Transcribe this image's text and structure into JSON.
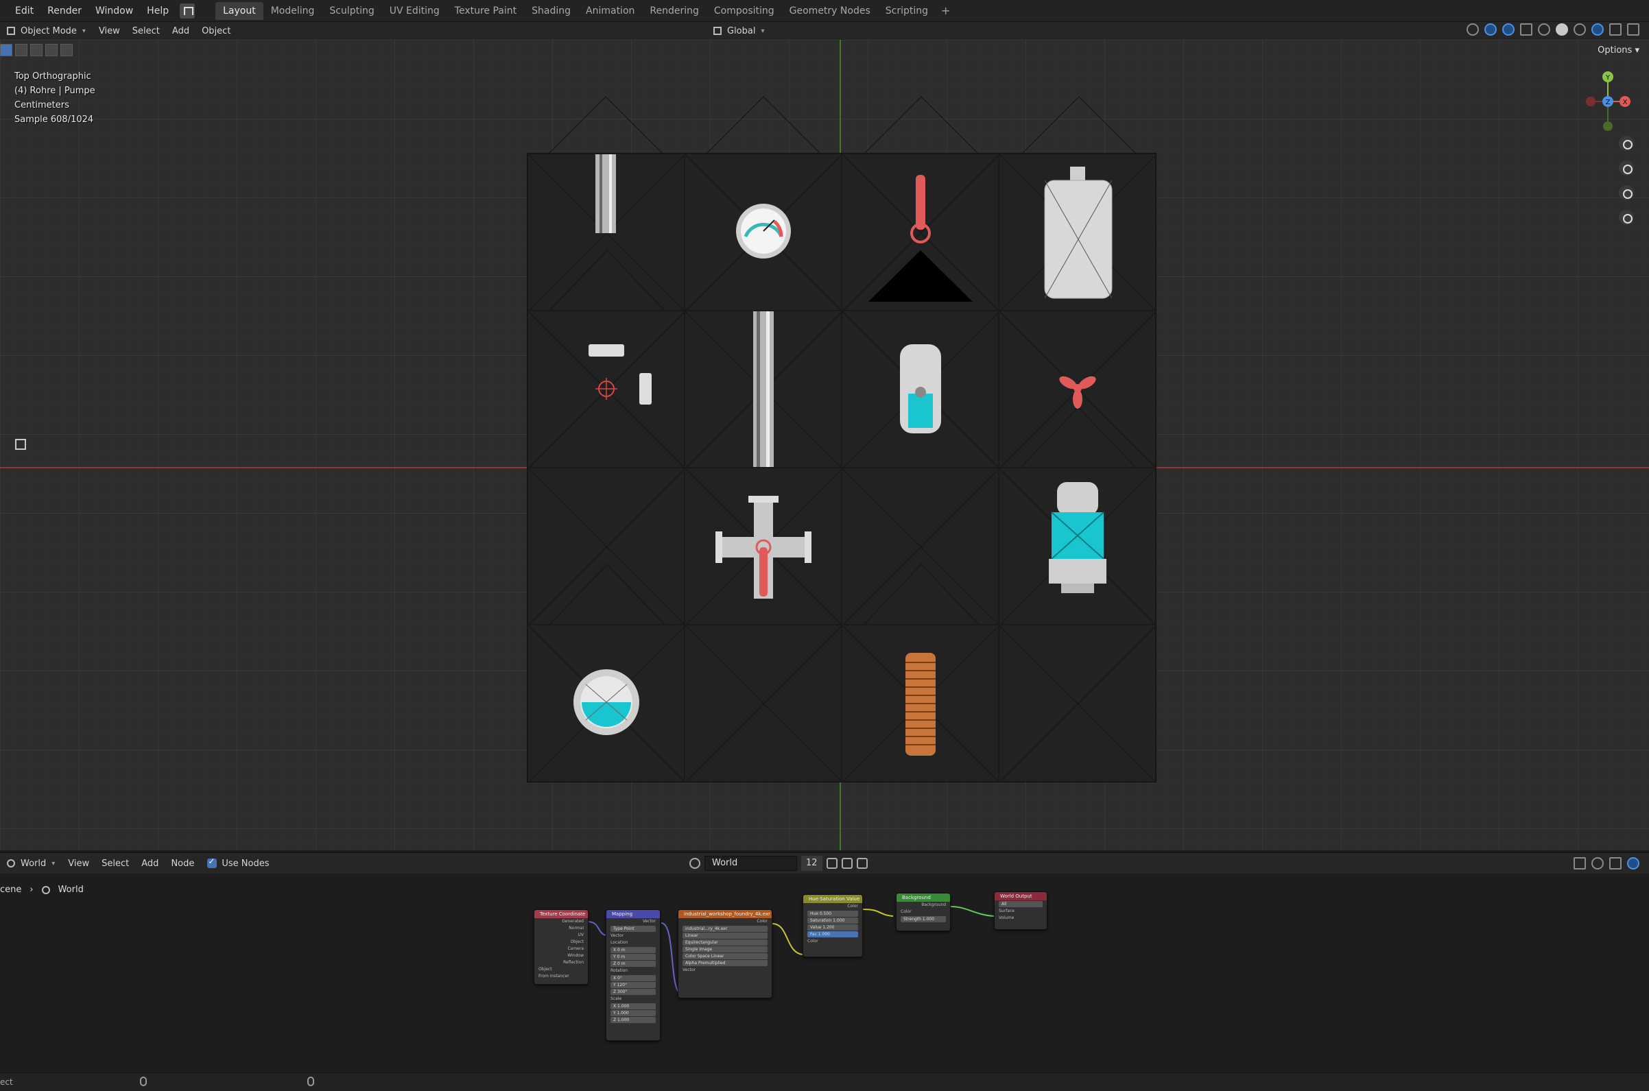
{
  "topbar": {
    "menus": [
      "Edit",
      "Render",
      "Window",
      "Help"
    ],
    "workspaces": [
      "Layout",
      "Modeling",
      "Sculpting",
      "UV Editing",
      "Texture Paint",
      "Shading",
      "Animation",
      "Rendering",
      "Compositing",
      "Geometry Nodes",
      "Scripting"
    ],
    "active_workspace": "Layout",
    "add_label": "+"
  },
  "viewport_header": {
    "mode": "Object Mode",
    "menus": [
      "View",
      "Select",
      "Add",
      "Object"
    ],
    "transform_orientation": "Global",
    "options_label": "Options"
  },
  "viewport": {
    "overlay_lines": [
      "Top Orthographic",
      "(4) Rohre | Pumpe",
      "Centimeters",
      "Sample 608/1024"
    ],
    "gizmo_labels": {
      "y": "Y",
      "z": "Z",
      "x": "X"
    }
  },
  "node_editor": {
    "editor_type": "World",
    "menus": [
      "View",
      "Select",
      "Add",
      "Node"
    ],
    "use_nodes_label": "Use Nodes",
    "world_name": "World",
    "user_count": "12",
    "breadcrumb": [
      "cene",
      "World"
    ],
    "nodes": {
      "texcoord": {
        "title": "Texture Coordinate",
        "rows": [
          "Generated",
          "Normal",
          "UV",
          "Object",
          "Camera",
          "Window",
          "Reflection"
        ],
        "object_label": "Object",
        "from_instancer": "From Instancer"
      },
      "mapping": {
        "title": "Mapping",
        "out": "Vector",
        "type_label": "Type",
        "type_value": "Point",
        "rows": [
          "Vector",
          "Location",
          "Rotation",
          "Scale"
        ],
        "loc": [
          "X  0 m",
          "Y  0 m",
          "Z  0 m"
        ],
        "rot": [
          "X  0°",
          "Y  120°",
          "Z  300°"
        ],
        "scale": [
          "X  1.000",
          "Y  1.000",
          "Z  1.000"
        ]
      },
      "envtex": {
        "title": "industrial_workshop_foundry_4k.exr",
        "out": "Color",
        "image": "industrial...ry_4k.exr",
        "interp": "Linear",
        "proj": "Equirectangular",
        "ext": "Single Image",
        "colorspace_label": "Color Space",
        "colorspace": "Linear",
        "alpha_label": "Alpha",
        "alpha": "Premultiplied",
        "in": "Vector"
      },
      "hsv": {
        "title": "Hue Saturation Value",
        "out": "Color",
        "fields": [
          "Hue  0.500",
          "Saturation  1.000",
          "Value  1.200",
          "Fac  1.000"
        ],
        "in": "Color"
      },
      "background": {
        "title": "Background",
        "out": "Background",
        "in1": "Color",
        "strength": "Strength  1.000"
      },
      "output": {
        "title": "World Output",
        "target": "All",
        "in1": "Surface",
        "in2": "Volume"
      }
    }
  },
  "statusbar": {
    "left_text": "ect"
  },
  "colors": {
    "accent": "#4772b3",
    "x_axis": "#8e3535",
    "y_axis": "#3f7a28",
    "cyan": "#19c6d0",
    "red_part": "#e05a5a",
    "copper": "#c8743a"
  }
}
